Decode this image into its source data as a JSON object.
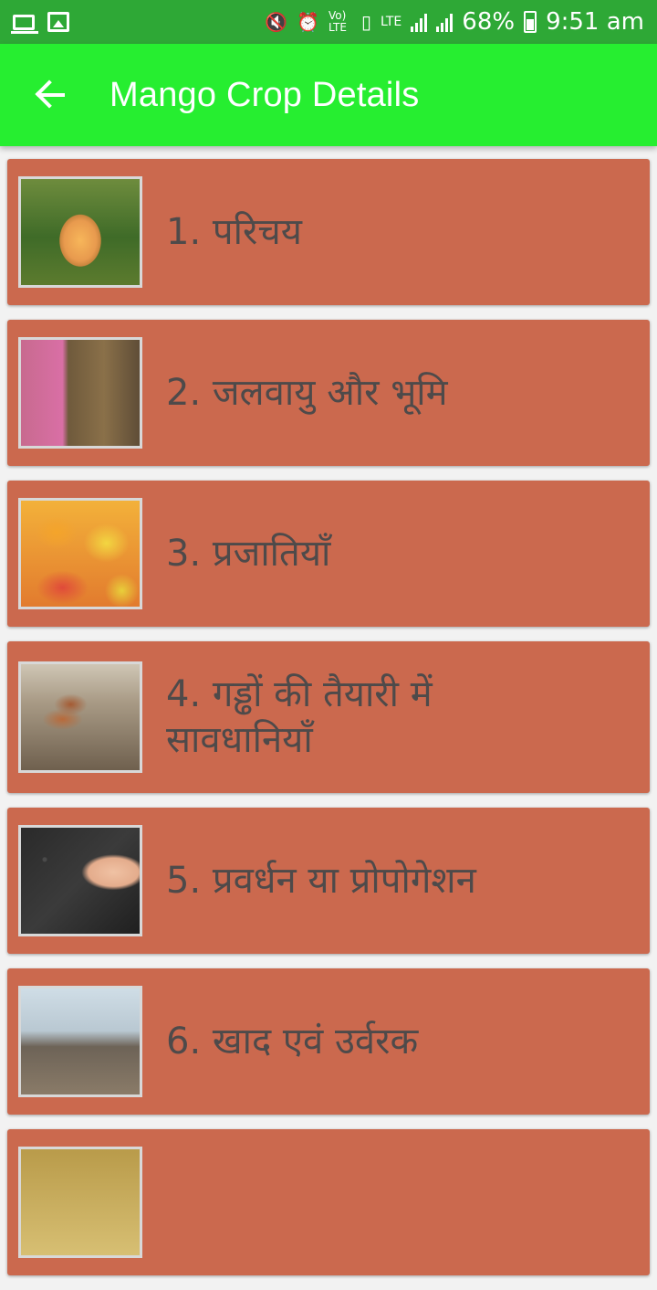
{
  "status_bar": {
    "battery_percent": "68%",
    "time": "9:51 am",
    "network_label": "LTE",
    "volte_label": "Vo) LTE"
  },
  "toolbar": {
    "title": "Mango Crop Details",
    "back_icon": "arrow-left-icon"
  },
  "colors": {
    "status_bar": "#2ea836",
    "toolbar": "#26ee30",
    "card": "#cb694e",
    "card_text": "#4e4a4a"
  },
  "items": [
    {
      "label": "1. परिचय"
    },
    {
      "label": "2. जलवायु और भूमि"
    },
    {
      "label": "3. प्रजातियाँ"
    },
    {
      "label": "4. गड्ढों की तैयारी में सावधानियाँ"
    },
    {
      "label": "5. प्रवर्धन या प्रोपोगेशन"
    },
    {
      "label": "6. खाद एवं उर्वरक"
    },
    {
      "label": ""
    }
  ]
}
